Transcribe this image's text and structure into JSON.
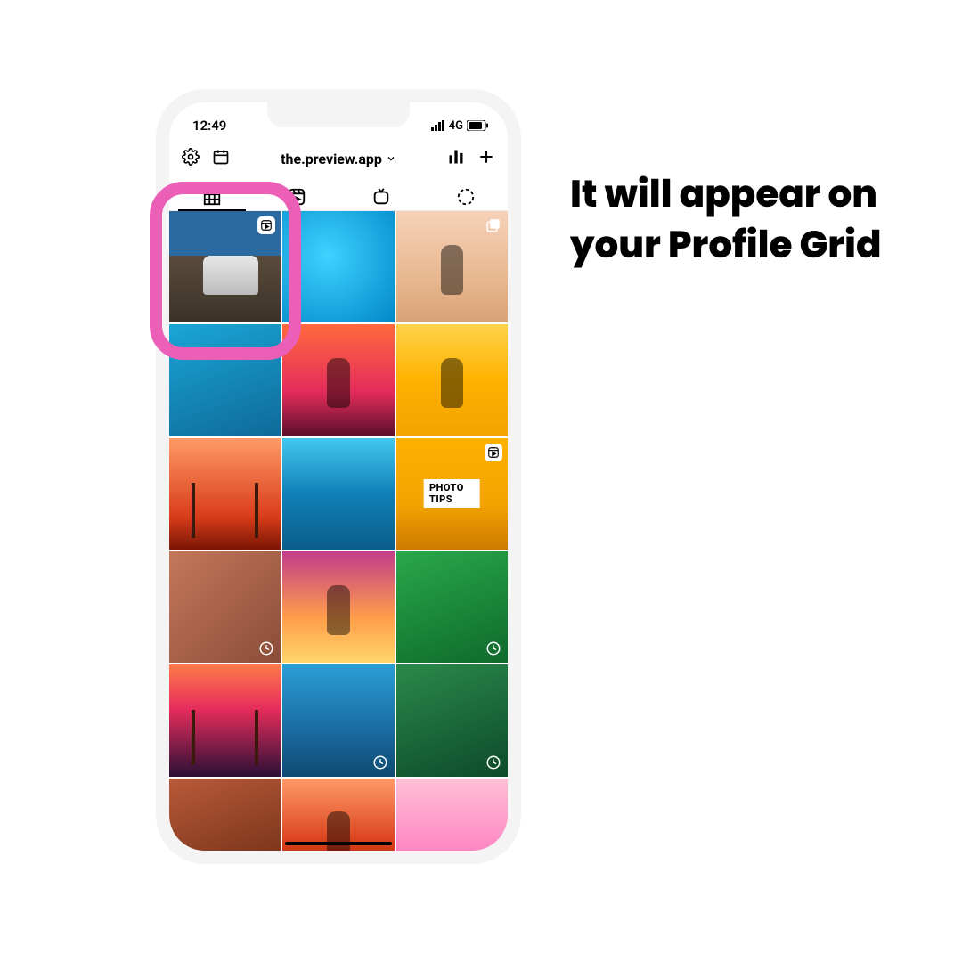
{
  "status": {
    "time": "12:49",
    "network": "4G"
  },
  "toolbar": {
    "username": "the.preview.app"
  },
  "grid": {
    "items": [
      {
        "badge": "reel"
      },
      {},
      {
        "badge": "carousel"
      },
      {},
      {},
      {},
      {},
      {},
      {
        "badge": "reel",
        "label": "PHOTO TIPS"
      },
      {
        "badge": "clock"
      },
      {},
      {
        "badge": "clock"
      },
      {},
      {
        "badge": "clock"
      },
      {
        "badge": "clock"
      },
      {},
      {},
      {}
    ]
  },
  "caption": "It will appear on your Profile Grid"
}
